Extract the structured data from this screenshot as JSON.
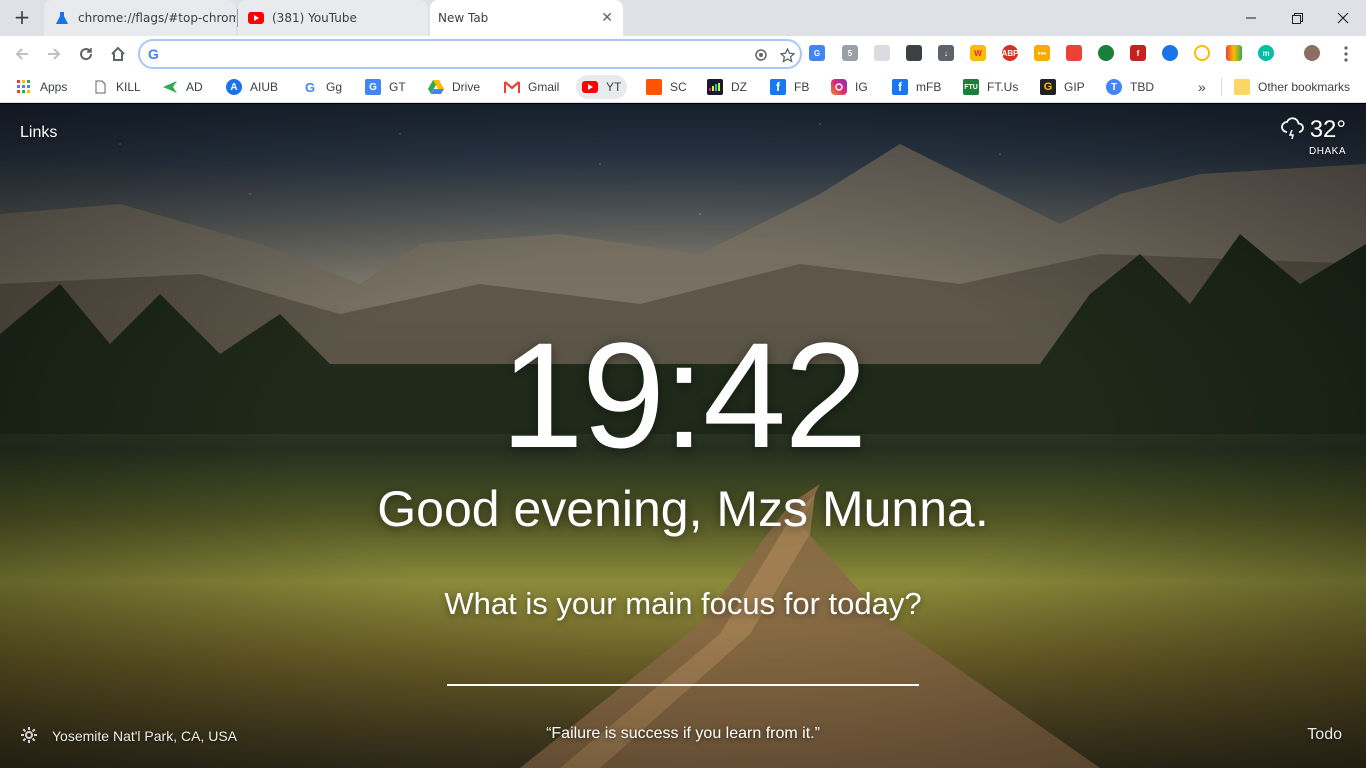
{
  "browser": {
    "tabs": [
      {
        "title": "chrome://flags/#top-chrome",
        "icon": "flask-icon"
      },
      {
        "title": "(381) YouTube",
        "icon": "youtube-icon"
      },
      {
        "title": "New Tab",
        "icon": "none"
      }
    ],
    "new_tab_symbol": "+",
    "close_symbol": "✕",
    "omnibox": {
      "value": "",
      "placeholder": ""
    },
    "bookmarks": [
      {
        "label": "Apps",
        "icon": "apps-grid-icon"
      },
      {
        "label": "KILL",
        "icon": "page-icon"
      },
      {
        "label": "AD",
        "icon": "ad-arrow-icon"
      },
      {
        "label": "AIUB",
        "icon": "aiub-icon"
      },
      {
        "label": "Gg",
        "icon": "google-icon"
      },
      {
        "label": "GT",
        "icon": "google-translate-icon"
      },
      {
        "label": "Drive",
        "icon": "google-drive-icon"
      },
      {
        "label": "Gmail",
        "icon": "gmail-icon"
      },
      {
        "label": "YT",
        "icon": "youtube-icon"
      },
      {
        "label": "SC",
        "icon": "soundcloud-icon"
      },
      {
        "label": "DZ",
        "icon": "deezer-icon"
      },
      {
        "label": "FB",
        "icon": "facebook-icon"
      },
      {
        "label": "IG",
        "icon": "instagram-icon"
      },
      {
        "label": "mFB",
        "icon": "facebook-icon"
      },
      {
        "label": "FT.Us",
        "icon": "ftu-icon"
      },
      {
        "label": "GIP",
        "icon": "gip-icon"
      },
      {
        "label": "TBD",
        "icon": "tbd-icon"
      }
    ],
    "overflow_symbol": "»",
    "other_bookmarks": "Other bookmarks"
  },
  "momentum": {
    "links_label": "Links",
    "weather": {
      "temp": "32°",
      "location": "DHAKA",
      "icon": "cloud-lightning-icon"
    },
    "clock": "19:42",
    "greeting": "Good evening, Mzs Munna.",
    "focus_question": "What is your main focus for today?",
    "focus_value": "",
    "photo_location": "Yosemite Nat'l Park, CA, USA",
    "quote": "“Failure is success if you learn from it.”",
    "todo_label": "Todo"
  },
  "colors": {
    "accent_blue": "#1a73e8",
    "tab_strip": "#dee1e6",
    "youtube_red": "#ff0000"
  }
}
